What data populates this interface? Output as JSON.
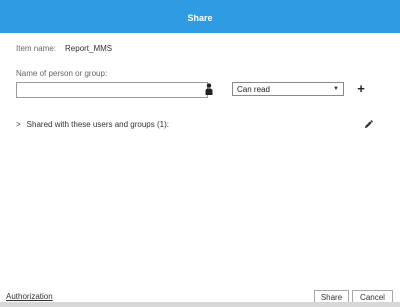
{
  "dialog": {
    "title": "Share"
  },
  "item": {
    "label": "Item name:",
    "value": "Report_MMS"
  },
  "person_field": {
    "label": "Name of person or group:",
    "value": "",
    "placeholder": ""
  },
  "permission": {
    "selected": "Can read",
    "caret_icon": "triangle-down-icon"
  },
  "add_button": {
    "label": "+"
  },
  "shared_section": {
    "label": "Shared with these users and groups (1):",
    "chevron": ">"
  },
  "icons": {
    "person": "person-icon",
    "edit": "pencil-icon"
  },
  "footer": {
    "authorization_link": "Authorization",
    "share_label": "Share",
    "cancel_label": "Cancel"
  },
  "colors": {
    "titlebar": "#2e9be3",
    "title_text": "#ffffff"
  }
}
